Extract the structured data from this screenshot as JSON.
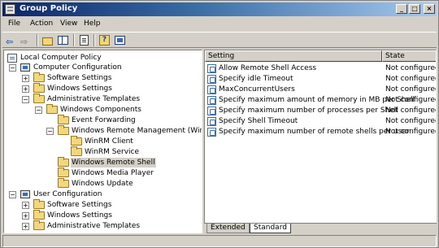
{
  "window": {
    "title": "Group Policy",
    "controls": {
      "minimize": "_",
      "maximize": "□",
      "close": "×"
    }
  },
  "menu": [
    "File",
    "Action",
    "View",
    "Help"
  ],
  "toolbar": {
    "icons": [
      "back-arrow-icon",
      "forward-arrow-icon",
      "up-folder-icon",
      "show-hide-tree-icon",
      "properties-icon",
      "help-icon",
      "view-icon"
    ],
    "back_glyph": "⇦",
    "forward_glyph": "⇨"
  },
  "tree": {
    "expand_glyph": "+",
    "collapse_glyph": "−",
    "nodes": [
      {
        "label": "Local Computer Policy",
        "icon": "policy-icon"
      },
      {
        "label": "Computer Configuration",
        "icon": "computer-icon",
        "toggle": "collapse"
      },
      {
        "label": "Software Settings",
        "icon": "folder-icon",
        "toggle": "expand"
      },
      {
        "label": "Windows Settings",
        "icon": "folder-icon",
        "toggle": "expand"
      },
      {
        "label": "Administrative Templates",
        "icon": "folder-icon",
        "toggle": "collapse"
      },
      {
        "label": "Windows Components",
        "icon": "folder-icon",
        "toggle": "collapse"
      },
      {
        "label": "Event Forwarding",
        "icon": "folder-icon"
      },
      {
        "label": "Windows Remote Management (WinRM)",
        "icon": "folder-icon",
        "toggle": "collapse"
      },
      {
        "label": "WinRM Client",
        "icon": "folder-icon"
      },
      {
        "label": "WinRM Service",
        "icon": "folder-icon"
      },
      {
        "label": "Windows Remote Shell",
        "icon": "folder-icon",
        "selected": true
      },
      {
        "label": "Windows Media Player",
        "icon": "folder-icon"
      },
      {
        "label": "Windows Update",
        "icon": "folder-icon"
      },
      {
        "label": "User Configuration",
        "icon": "computer-icon",
        "toggle": "collapse"
      },
      {
        "label": "Software Settings",
        "icon": "folder-icon",
        "toggle": "expand"
      },
      {
        "label": "Windows Settings",
        "icon": "folder-icon",
        "toggle": "expand"
      },
      {
        "label": "Administrative Templates",
        "icon": "folder-icon",
        "toggle": "expand"
      }
    ]
  },
  "list": {
    "columns": [
      "Setting",
      "State"
    ],
    "rows": [
      {
        "setting": "Allow Remote Shell Access",
        "state": "Not configured"
      },
      {
        "setting": "Specify idle Timeout",
        "state": "Not configured"
      },
      {
        "setting": "MaxConcurrentUsers",
        "state": "Not configured"
      },
      {
        "setting": "Specify maximum amount of memory in MB per Shell",
        "state": "Not configured"
      },
      {
        "setting": "Specify maximum number of processes per Shell",
        "state": "Not configured"
      },
      {
        "setting": "Specify Shell Timeout",
        "state": "Not configured"
      },
      {
        "setting": "Specify maximum number of remote shells per user",
        "state": "Not configured"
      }
    ]
  },
  "tabs": {
    "extended": "Extended",
    "standard": "Standard",
    "active": "Standard"
  }
}
